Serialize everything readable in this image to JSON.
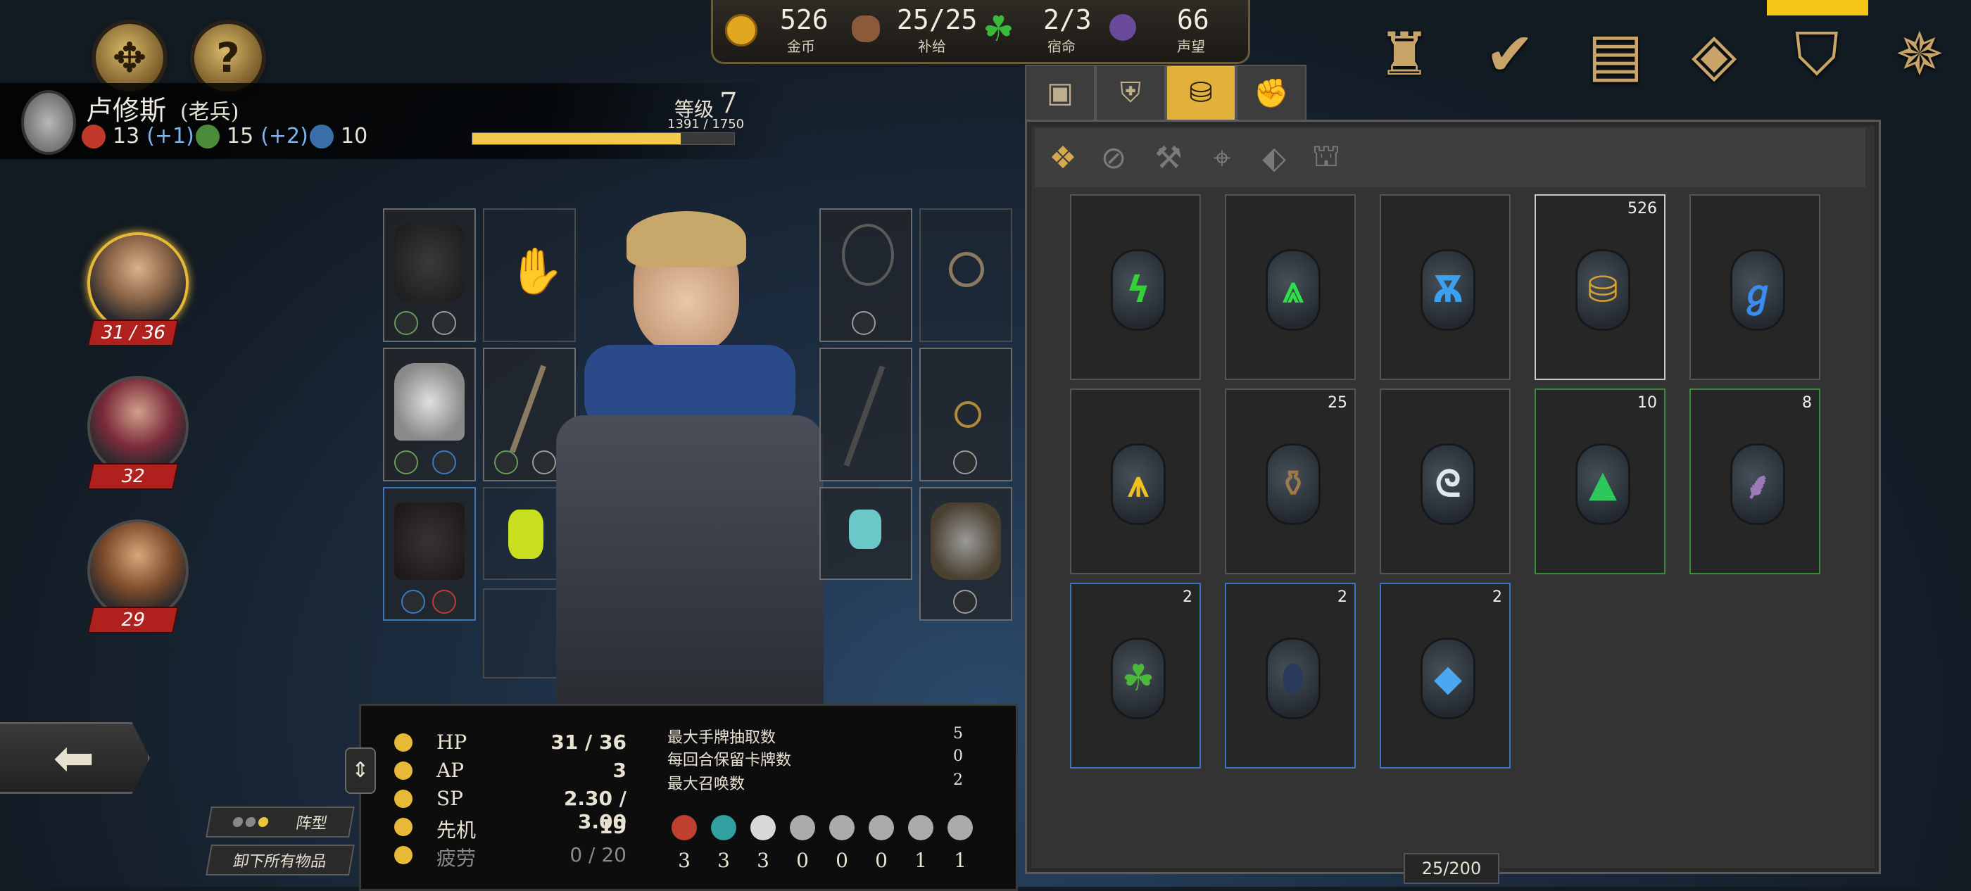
{
  "header_left": {
    "hero_name": "卢修斯",
    "hero_class": "(老兵)",
    "attributes": [
      {
        "icon": "strength-fist-icon",
        "value": "13",
        "bonus": "(+1)",
        "color": "#c0392b"
      },
      {
        "icon": "agility-icon",
        "value": "15",
        "bonus": "(+2)",
        "color": "#4c8a3c"
      },
      {
        "icon": "intellect-book-icon",
        "value": "10",
        "bonus": "",
        "color": "#3a6ea8"
      }
    ],
    "level_label": "等级",
    "level_value": "7",
    "xp_text": "1391 / 1750",
    "xp_progress": 0.795
  },
  "resources": [
    {
      "icon": "gold-coin-icon",
      "value": "526",
      "label": "金币"
    },
    {
      "icon": "supply-sack-icon",
      "value": "25/25",
      "label": "补给"
    },
    {
      "icon": "clover-fate-icon",
      "value": "2/3",
      "label": "宿命"
    },
    {
      "icon": "renown-gem-icon",
      "value": "66",
      "label": "声望"
    }
  ],
  "top_icons": [
    "castle-tower-icon",
    "check-quest-icon",
    "journal-book-icon",
    "map-grid-icon",
    "inventory-bag-icon",
    "compass-icon"
  ],
  "party": [
    {
      "hp": "31 / 36",
      "active": true
    },
    {
      "hp": "32",
      "active": false
    },
    {
      "hp": "29",
      "active": false
    }
  ],
  "inventory": {
    "capacity": "25/200",
    "items": [
      {
        "name": "rune-green-icon",
        "qty": "",
        "glyph": "ϟ",
        "color": "#36d03a",
        "border": "gray"
      },
      {
        "name": "rune-green-arrow-icon",
        "qty": "",
        "glyph": "⩓",
        "color": "#2ee04a",
        "border": "gray"
      },
      {
        "name": "rune-blue-icon",
        "qty": "",
        "glyph": "Ѫ",
        "color": "#3aa0f0",
        "border": "gray"
      },
      {
        "name": "gold-sack-icon",
        "qty": "526",
        "glyph": "⛁",
        "color": "#d8a030",
        "border": "white"
      },
      {
        "name": "rune-blue-spiral-icon",
        "qty": "",
        "glyph": "ℊ",
        "color": "#3a8cf0",
        "border": "gray"
      },
      {
        "name": "rune-yellow-icon",
        "qty": "",
        "glyph": "⩚",
        "color": "#f0c020",
        "border": "gray"
      },
      {
        "name": "supply-pack-icon",
        "qty": "25",
        "glyph": "⚱",
        "color": "#a0784a",
        "border": "gray"
      },
      {
        "name": "rune-white-swirl-icon",
        "qty": "",
        "glyph": "ᘓ",
        "color": "#e0e6f0",
        "border": "gray"
      },
      {
        "name": "green-powder-icon",
        "qty": "10",
        "glyph": "▲",
        "color": "#2ec85a",
        "border": "green"
      },
      {
        "name": "incense-stick-icon",
        "qty": "8",
        "glyph": "⸙",
        "color": "#9a7ab8",
        "border": "green"
      },
      {
        "name": "four-leaf-clover-icon",
        "qty": "2",
        "glyph": "☘",
        "color": "#4ab83a",
        "border": "blue"
      },
      {
        "name": "dark-stone-icon",
        "qty": "2",
        "glyph": "⬮",
        "color": "#2a3a5a",
        "border": "blue"
      },
      {
        "name": "blue-crystal-icon",
        "qty": "2",
        "glyph": "◆",
        "color": "#4aa8f0",
        "border": "blue"
      }
    ]
  },
  "stats": {
    "rows": [
      {
        "name": "HP",
        "value": "31 / 36"
      },
      {
        "name": "AP",
        "value": "3"
      },
      {
        "name": "SP",
        "value": "2.30 / 3.00"
      },
      {
        "name": "先机",
        "value": "19"
      },
      {
        "name": "疲劳",
        "value": "0 / 20"
      }
    ],
    "counters": [
      {
        "label": "最大手牌抽取数",
        "value": "5"
      },
      {
        "label": "每回合保留卡牌数",
        "value": "0"
      },
      {
        "label": "最大召唤数",
        "value": "2"
      }
    ],
    "resist_values": [
      "3",
      "3",
      "3",
      "0",
      "0",
      "0",
      "1",
      "1"
    ]
  },
  "controls": {
    "formation": "阵型",
    "unequip_all": "卸下所有物品"
  }
}
